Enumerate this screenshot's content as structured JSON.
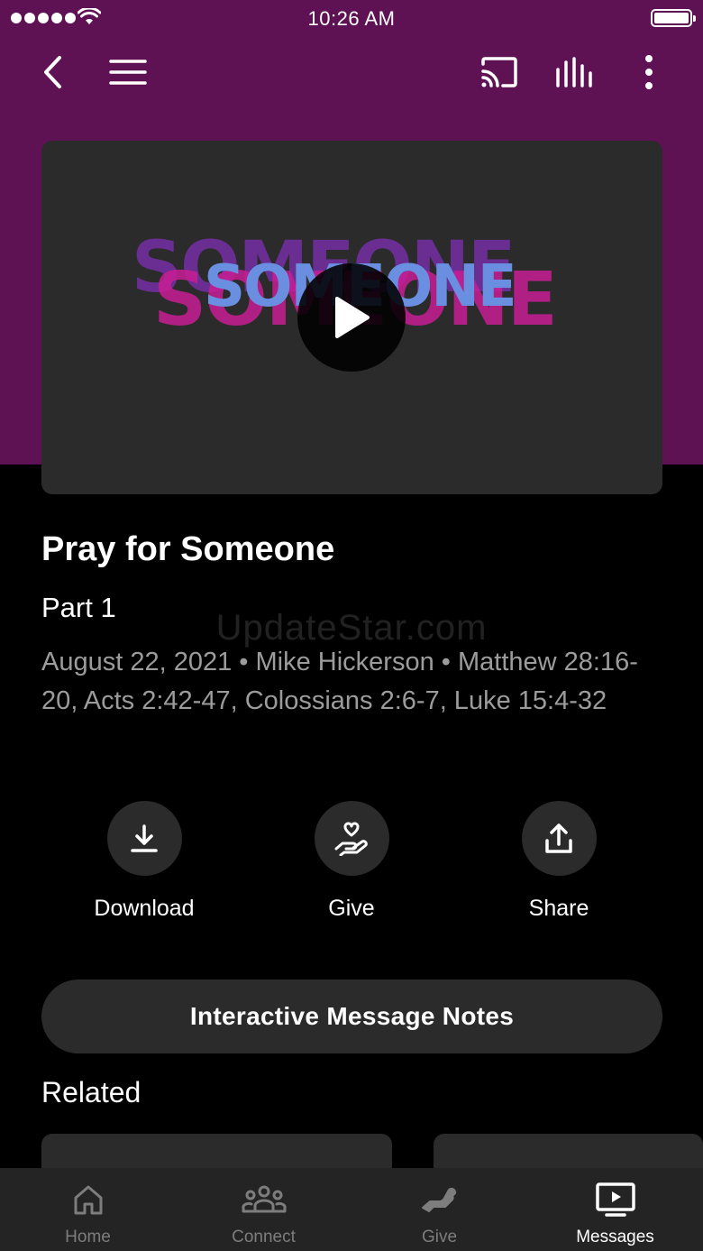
{
  "status_bar": {
    "time": "10:26 AM"
  },
  "video": {
    "artwork_text": "SOMEONE",
    "colors": {
      "hero_bg": "#5e1254",
      "art_purple": "#6a2e93",
      "art_pink": "#c81e94",
      "art_blue": "#6b8fe0"
    }
  },
  "message": {
    "title": "Pray for Someone",
    "subtitle": "Part 1",
    "meta": "August 22, 2021 • Mike Hickerson • Matthew 28:16-20, Acts 2:42-47, Colossians 2:6-7, Luke 15:4-32"
  },
  "watermark": "UpdateStar.com",
  "actions": [
    {
      "label": "Download",
      "icon": "download-icon"
    },
    {
      "label": "Give",
      "icon": "give-hand-heart-icon"
    },
    {
      "label": "Share",
      "icon": "share-icon"
    }
  ],
  "notes_button": {
    "label": "Interactive Message Notes"
  },
  "related": {
    "heading": "Related"
  },
  "tabs": [
    {
      "label": "Home",
      "icon": "home-icon",
      "active": false
    },
    {
      "label": "Connect",
      "icon": "people-icon",
      "active": false
    },
    {
      "label": "Give",
      "icon": "give-icon",
      "active": false
    },
    {
      "label": "Messages",
      "icon": "tv-play-icon",
      "active": true
    }
  ]
}
